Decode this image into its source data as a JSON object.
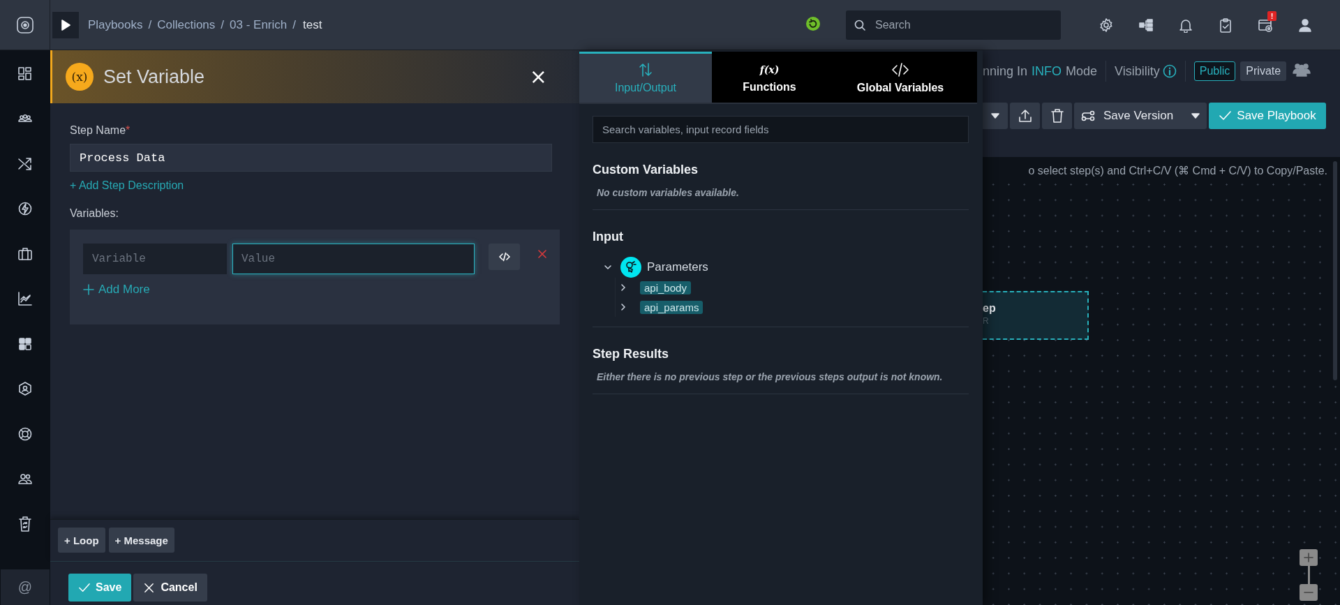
{
  "top_bar": {
    "breadcrumbs": [
      {
        "label": "Playbooks",
        "separator": "/"
      },
      {
        "label": "Collections",
        "separator": "/"
      },
      {
        "label": "03 - Enrich",
        "separator": "/"
      },
      {
        "label": "test"
      }
    ],
    "search": {
      "placeholder": "Search"
    },
    "notification_badge": "!"
  },
  "sidebar": {
    "bottom_label": "@"
  },
  "step_panel": {
    "title": "Set Variable",
    "icon_text": "(x)",
    "close": "×",
    "step_name": {
      "label": "Step Name",
      "required_mark": "*",
      "value": "Process Data"
    },
    "add_description": "+ Add Step Description",
    "variables_label": "Variables:",
    "variables": [
      {
        "name_placeholder": "Variable",
        "value_placeholder": "Value",
        "focused": true
      }
    ],
    "add_more": "Add More",
    "footer_buttons": [
      {
        "label": "+ Loop"
      },
      {
        "label": "+ Message"
      }
    ],
    "actions": [
      {
        "label": "Save",
        "kind": "primary"
      },
      {
        "label": "Cancel",
        "kind": "secondary"
      }
    ]
  },
  "variable_panel": {
    "tabs": [
      {
        "label": "Input/Output",
        "kind": "io",
        "selected": true
      },
      {
        "label": "Functions",
        "kind": "functions",
        "icon_text": "f(x)",
        "selected": false
      },
      {
        "label": "Global Variables",
        "kind": "code",
        "selected": false
      }
    ],
    "search": {
      "placeholder": "Search variables, input record fields"
    },
    "sections": [
      {
        "title": "Custom Variables",
        "note": "No custom variables available."
      },
      {
        "title": "Input",
        "tree": [
          {
            "label": "Parameters",
            "kind": "group",
            "expanded": true,
            "children": [
              {
                "label": "api_body",
                "kind": "field",
                "expanded": false
              },
              {
                "label": "api_params",
                "kind": "field",
                "expanded": false
              }
            ]
          }
        ]
      },
      {
        "title": "Step Results",
        "note": "Either there is no previous step or the previous steps output is not known."
      }
    ]
  },
  "editor": {
    "mode": {
      "prefix": "nning In",
      "level": "INFO",
      "suffix": "Mode"
    },
    "visibility": {
      "label": "Visibility",
      "options": [
        {
          "label": "Public",
          "selected": true
        },
        {
          "label": "Private",
          "selected": false
        }
      ]
    },
    "save_version": "Save Version",
    "save_playbook": "Save Playbook",
    "hint": "o select step(s) and Ctrl+C/V (⌘ Cmd + C/V) to Copy/Paste.",
    "node": {
      "title": "ep",
      "subtitle": "R"
    }
  }
}
